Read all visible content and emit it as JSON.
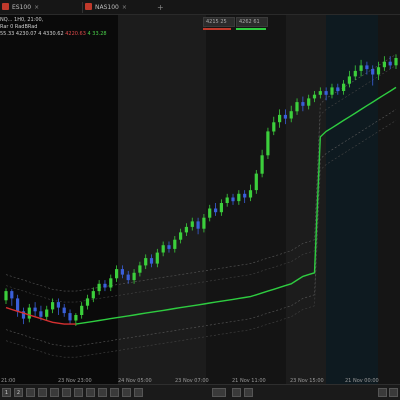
{
  "window": {
    "tabs": [
      {
        "label": "ES100",
        "close": "×"
      },
      {
        "label": "NAS100",
        "close": "×"
      }
    ],
    "add_tab": "+"
  },
  "legend": {
    "line1": "NQ... 1H0, 21:00,",
    "line2": "Rar 0 RadBRad",
    "line3_a": "55.33",
    "line3_b": "4230.07 4 4330.62",
    "line3_neg": "4220.63",
    "line3_pos": "4 33.28"
  },
  "mini_panel": {
    "value1": "4215 25",
    "value2": "4262 61"
  },
  "time_ticks": [
    "21:00",
    "23 Nov 23:00",
    "24 Nov 05:00",
    "23 Nov 07:00",
    "21 Nov 11:00",
    "23 Nov 15:00",
    "21 Nov 00:00"
  ],
  "colors": {
    "bull": "#3ccf3c",
    "bear": "#3a5fd9",
    "ma": "#2ecc40",
    "ma_red": "#d63031",
    "band_shade": "#1f1f1f",
    "band_blue": "#0f1b22"
  },
  "chart_data": {
    "type": "candlestick",
    "series": [
      {
        "name": "price",
        "values": [
          {
            "o": 12,
            "c": 22,
            "h": 25,
            "l": 8
          },
          {
            "o": 22,
            "c": 14,
            "h": 24,
            "l": 6
          },
          {
            "o": 14,
            "c": 0,
            "h": 18,
            "l": -6
          },
          {
            "o": 0,
            "c": -8,
            "h": 4,
            "l": -14
          },
          {
            "o": -8,
            "c": 4,
            "h": 8,
            "l": -12
          },
          {
            "o": 4,
            "c": 0,
            "h": 10,
            "l": -6
          },
          {
            "o": 0,
            "c": -6,
            "h": 6,
            "l": -10
          },
          {
            "o": -6,
            "c": 2,
            "h": 6,
            "l": -10
          },
          {
            "o": 2,
            "c": 10,
            "h": 14,
            "l": -2
          },
          {
            "o": 10,
            "c": 4,
            "h": 14,
            "l": -4
          },
          {
            "o": 4,
            "c": -2,
            "h": 8,
            "l": -6
          },
          {
            "o": -2,
            "c": -10,
            "h": 2,
            "l": -14
          },
          {
            "o": -10,
            "c": -4,
            "h": -2,
            "l": -16
          },
          {
            "o": -4,
            "c": 6,
            "h": 10,
            "l": -8
          },
          {
            "o": 6,
            "c": 14,
            "h": 18,
            "l": 2
          },
          {
            "o": 14,
            "c": 22,
            "h": 26,
            "l": 10
          },
          {
            "o": 22,
            "c": 30,
            "h": 34,
            "l": 18
          },
          {
            "o": 30,
            "c": 26,
            "h": 34,
            "l": 22
          },
          {
            "o": 26,
            "c": 36,
            "h": 40,
            "l": 22
          },
          {
            "o": 36,
            "c": 46,
            "h": 50,
            "l": 32
          },
          {
            "o": 46,
            "c": 40,
            "h": 50,
            "l": 36
          },
          {
            "o": 40,
            "c": 34,
            "h": 44,
            "l": 30
          },
          {
            "o": 34,
            "c": 42,
            "h": 46,
            "l": 30
          },
          {
            "o": 42,
            "c": 50,
            "h": 54,
            "l": 38
          },
          {
            "o": 50,
            "c": 58,
            "h": 62,
            "l": 46
          },
          {
            "o": 58,
            "c": 52,
            "h": 62,
            "l": 48
          },
          {
            "o": 52,
            "c": 64,
            "h": 68,
            "l": 48
          },
          {
            "o": 64,
            "c": 72,
            "h": 76,
            "l": 60
          },
          {
            "o": 72,
            "c": 68,
            "h": 76,
            "l": 64
          },
          {
            "o": 68,
            "c": 78,
            "h": 82,
            "l": 64
          },
          {
            "o": 78,
            "c": 86,
            "h": 90,
            "l": 74
          },
          {
            "o": 86,
            "c": 92,
            "h": 96,
            "l": 82
          },
          {
            "o": 92,
            "c": 98,
            "h": 102,
            "l": 88
          },
          {
            "o": 98,
            "c": 90,
            "h": 102,
            "l": 84
          },
          {
            "o": 90,
            "c": 102,
            "h": 106,
            "l": 86
          },
          {
            "o": 102,
            "c": 112,
            "h": 116,
            "l": 98
          },
          {
            "o": 112,
            "c": 108,
            "h": 118,
            "l": 104
          },
          {
            "o": 108,
            "c": 118,
            "h": 122,
            "l": 104
          },
          {
            "o": 118,
            "c": 124,
            "h": 128,
            "l": 114
          },
          {
            "o": 124,
            "c": 120,
            "h": 128,
            "l": 116
          },
          {
            "o": 120,
            "c": 128,
            "h": 132,
            "l": 116
          },
          {
            "o": 128,
            "c": 124,
            "h": 132,
            "l": 118
          },
          {
            "o": 124,
            "c": 132,
            "h": 138,
            "l": 120
          },
          {
            "o": 132,
            "c": 150,
            "h": 154,
            "l": 128
          },
          {
            "o": 150,
            "c": 170,
            "h": 176,
            "l": 146
          },
          {
            "o": 170,
            "c": 196,
            "h": 200,
            "l": 166
          },
          {
            "o": 196,
            "c": 206,
            "h": 212,
            "l": 192
          },
          {
            "o": 206,
            "c": 214,
            "h": 220,
            "l": 200
          },
          {
            "o": 214,
            "c": 210,
            "h": 220,
            "l": 204
          },
          {
            "o": 210,
            "c": 218,
            "h": 224,
            "l": 206
          },
          {
            "o": 218,
            "c": 228,
            "h": 232,
            "l": 214
          },
          {
            "o": 228,
            "c": 224,
            "h": 234,
            "l": 218
          },
          {
            "o": 224,
            "c": 232,
            "h": 236,
            "l": 220
          },
          {
            "o": 232,
            "c": 236,
            "h": 240,
            "l": 228
          },
          {
            "o": 236,
            "c": 240,
            "h": 244,
            "l": 232
          },
          {
            "o": 240,
            "c": 236,
            "h": 244,
            "l": 230
          },
          {
            "o": 236,
            "c": 244,
            "h": 248,
            "l": 232
          },
          {
            "o": 244,
            "c": 240,
            "h": 248,
            "l": 236
          },
          {
            "o": 240,
            "c": 248,
            "h": 252,
            "l": 236
          },
          {
            "o": 248,
            "c": 256,
            "h": 262,
            "l": 244
          },
          {
            "o": 256,
            "c": 262,
            "h": 268,
            "l": 252
          },
          {
            "o": 262,
            "c": 268,
            "h": 274,
            "l": 256
          },
          {
            "o": 268,
            "c": 264,
            "h": 272,
            "l": 258
          },
          {
            "o": 264,
            "c": 258,
            "h": 268,
            "l": 246
          },
          {
            "o": 258,
            "c": 266,
            "h": 272,
            "l": 252
          },
          {
            "o": 266,
            "c": 272,
            "h": 278,
            "l": 262
          },
          {
            "o": 272,
            "c": 268,
            "h": 278,
            "l": 264
          },
          {
            "o": 268,
            "c": 276,
            "h": 280,
            "l": 264
          }
        ]
      },
      {
        "name": "ma",
        "values": [
          4,
          2,
          0,
          -2,
          -4,
          -6,
          -8,
          -10,
          -12,
          -13,
          -14,
          -14,
          -14,
          -13,
          -12,
          -11,
          -10,
          -9,
          -8,
          -7,
          -6,
          -5,
          -4,
          -3,
          -2,
          -1,
          0,
          1,
          2,
          3,
          4,
          5,
          6,
          7,
          8,
          9,
          10,
          11,
          12,
          13,
          14,
          15,
          16,
          18,
          20,
          22,
          24,
          26,
          28,
          30,
          34,
          38,
          40,
          42,
          190,
          196,
          200,
          204,
          208,
          212,
          216,
          220,
          224,
          228,
          232,
          236,
          240,
          244
        ]
      }
    ],
    "ma_red_until": 12,
    "ylim": [
      -40,
      300
    ]
  }
}
